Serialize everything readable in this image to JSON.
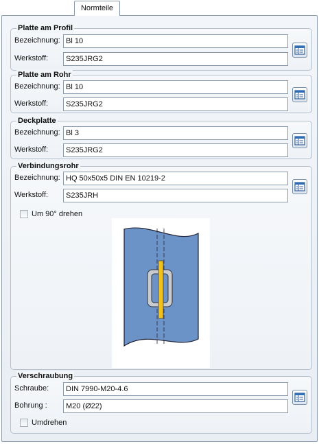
{
  "tab": {
    "label": "Normteile"
  },
  "groups": {
    "platte_profil": {
      "title": "Platte am Profil",
      "bezeichnung_label": "Bezeichnung:",
      "bezeichnung_value": "Bl 10",
      "werkstoff_label": "Werkstoff:",
      "werkstoff_value": "S235JRG2"
    },
    "platte_rohr": {
      "title": "Platte am Rohr",
      "bezeichnung_label": "Bezeichnung:",
      "bezeichnung_value": "Bl 10",
      "werkstoff_label": "Werkstoff:",
      "werkstoff_value": "S235JRG2"
    },
    "deckplatte": {
      "title": "Deckplatte",
      "bezeichnung_label": "Bezeichnung:",
      "bezeichnung_value": "Bl 3",
      "werkstoff_label": "Werkstoff:",
      "werkstoff_value": "S235JRG2"
    },
    "verbindungsrohr": {
      "title": "Verbindungsrohr",
      "bezeichnung_label": "Bezeichnung:",
      "bezeichnung_value": "HQ 50x50x5 DIN EN 10219-2",
      "werkstoff_label": "Werkstoff:",
      "werkstoff_value": "S235JRH",
      "rotate_label": "Um 90° drehen"
    },
    "verschraubung": {
      "title": "Verschraubung",
      "schraube_label": "Schraube:",
      "schraube_value": "DIN 7990-M20-4.6",
      "bohrung_label": "Bohrung :",
      "bohrung_value": "M20 (Ø22)",
      "flip_label": "Umdrehen"
    }
  },
  "icons": {
    "catalog": "catalog-table-icon",
    "preview": "connection-preview-drawing"
  },
  "colors": {
    "plate_blue": "#6b93c8",
    "bolt_yellow": "#f2c21a",
    "tube_gray": "#c8ccd0"
  }
}
